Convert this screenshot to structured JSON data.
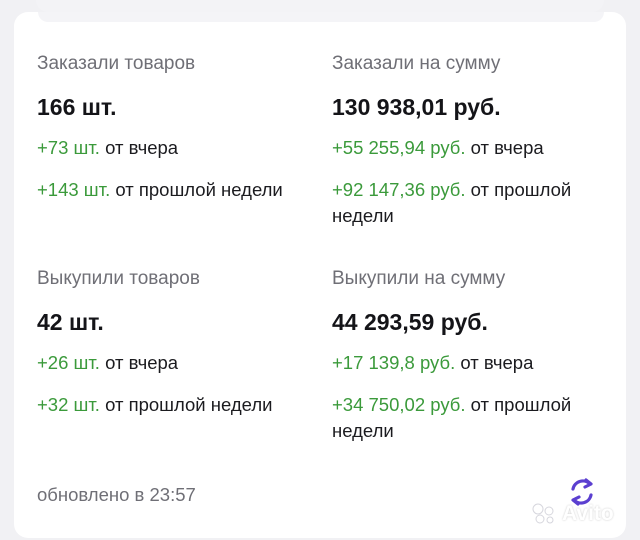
{
  "colors": {
    "positive_delta": "#3b9a3b",
    "label_gray": "#6f6f76",
    "refresh_icon": "#5b3fd0"
  },
  "ordered_qty": {
    "label": "Заказали товаров",
    "value": "166 шт.",
    "delta_day": {
      "value": "+73 шт.",
      "suffix": "от вчера"
    },
    "delta_week": {
      "value": "+143 шт.",
      "suffix": "от прошлой недели"
    }
  },
  "ordered_sum": {
    "label": "Заказали на сумму",
    "value": "130 938,01 руб.",
    "delta_day": {
      "value": "+55 255,94 руб.",
      "suffix": "от вчера"
    },
    "delta_week": {
      "value": "+92 147,36 руб.",
      "suffix": "от прошлой недели"
    }
  },
  "bought_qty": {
    "label": "Выкупили товаров",
    "value": "42 шт.",
    "delta_day": {
      "value": "+26 шт.",
      "suffix": "от вчера"
    },
    "delta_week": {
      "value": "+32 шт.",
      "suffix": "от прошлой недели"
    }
  },
  "bought_sum": {
    "label": "Выкупили на сумму",
    "value": "44 293,59 руб.",
    "delta_day": {
      "value": "+17 139,8 руб.",
      "suffix": "от вчера"
    },
    "delta_week": {
      "value": "+34 750,02 руб.",
      "suffix": "от прошлой недели"
    }
  },
  "footer": {
    "updated_text": "обновлено в 23:57"
  },
  "refresh": {
    "icon": "refresh-icon"
  },
  "watermark": {
    "text": "Avito",
    "icon": "avito-logo-icon"
  }
}
